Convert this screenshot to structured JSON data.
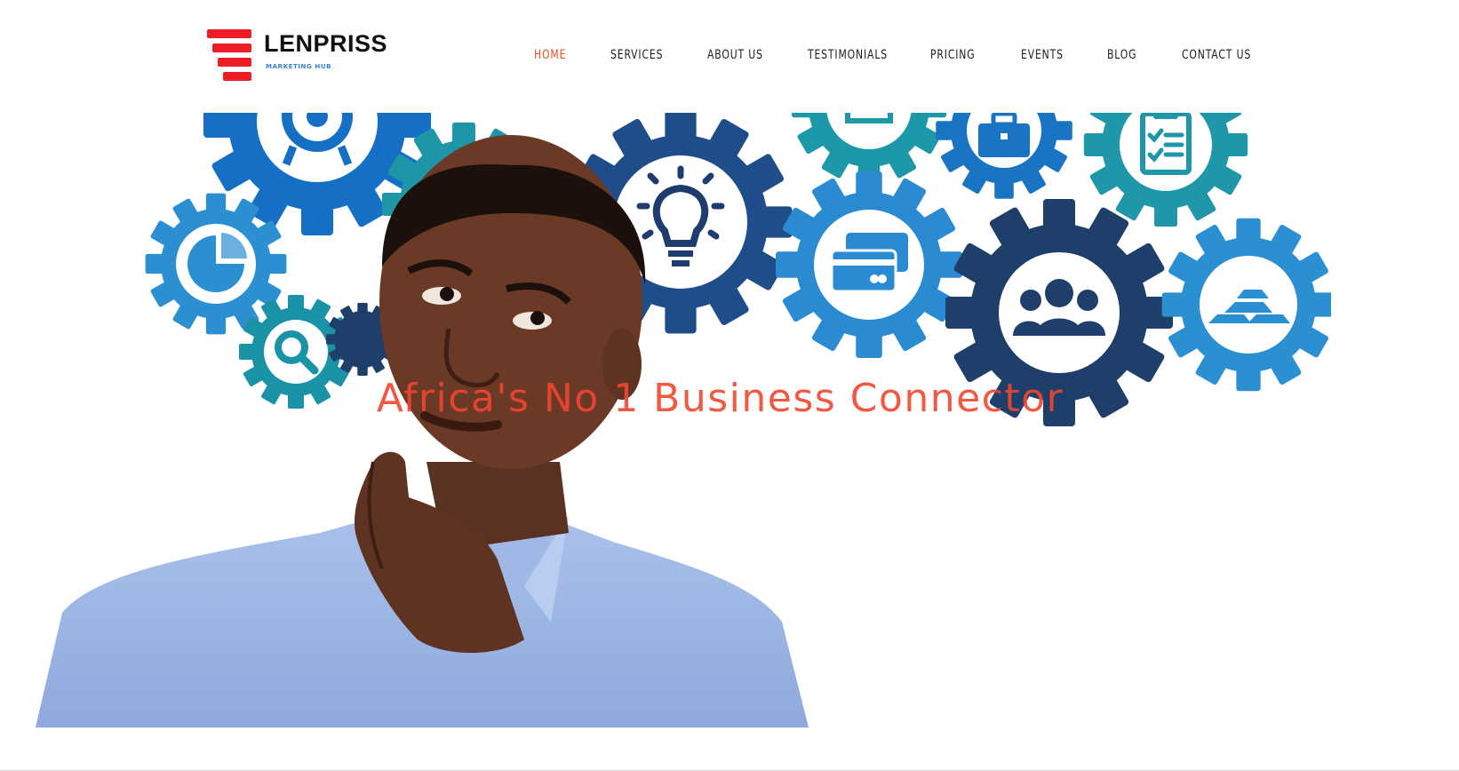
{
  "brand": {
    "name": "LENPRISS",
    "tagline": "MARKETING HUB",
    "accent_color": "#ee1c25"
  },
  "nav": {
    "items": [
      {
        "label": "HOME",
        "active": true
      },
      {
        "label": "SERVICES",
        "active": false
      },
      {
        "label": "ABOUT US",
        "active": false
      },
      {
        "label": "TESTIMONIALS",
        "active": false
      },
      {
        "label": "PRICING",
        "active": false
      },
      {
        "label": "EVENTS",
        "active": false
      },
      {
        "label": "BLOG",
        "active": false
      },
      {
        "label": "CONTACT US",
        "active": false
      }
    ],
    "active_color": "#f04e23"
  },
  "hero": {
    "title": "Africa's No 1 Business Connector",
    "title_color": "#f2462e",
    "gear_icons": [
      "target-icon",
      "lightbulb-icon",
      "document-icon",
      "briefcase-icon",
      "checklist-icon",
      "pie-chart-icon",
      "search-icon",
      "credit-card-icon",
      "team-icon",
      "gold-bars-icon"
    ]
  }
}
